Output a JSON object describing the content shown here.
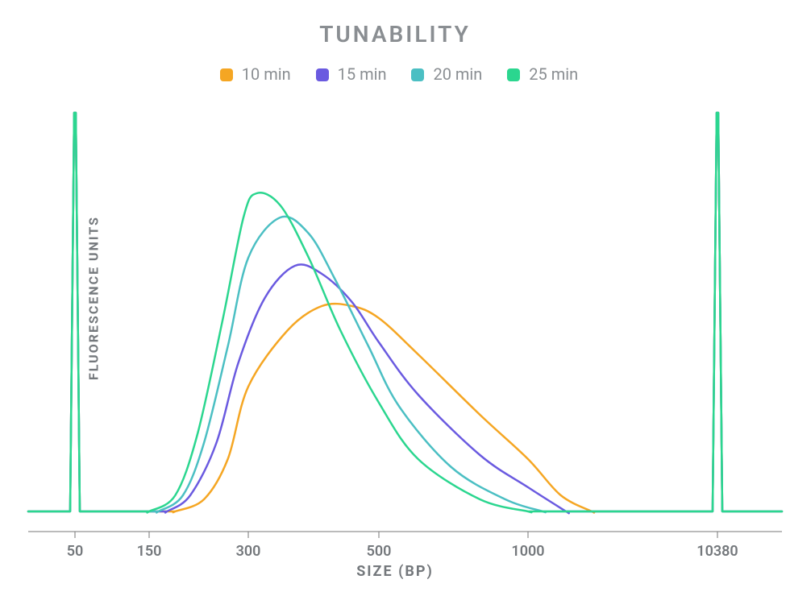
{
  "chart_data": {
    "type": "line",
    "title": "TUNABILITY",
    "xlabel": "SIZE (BP)",
    "ylabel": "FLUORESCENCE UNITS",
    "x_ticks": [
      50,
      150,
      300,
      500,
      1000,
      10380
    ],
    "x_axis_note": "logarithmic scale",
    "y_axis_note": "relative fluorescence, arbitrary units, baseline at 0",
    "legend": [
      {
        "name": "10 min",
        "color": "#f5a623"
      },
      {
        "name": "15 min",
        "color": "#6a5ae0"
      },
      {
        "name": "20 min",
        "color": "#4bbfc3"
      },
      {
        "name": "25 min",
        "color": "#2bd68f"
      }
    ],
    "marker_peaks": [
      {
        "x": 50,
        "height_rel": 1.0,
        "note": "lower marker spike, all series overlap"
      },
      {
        "x": 10380,
        "height_rel": 1.0,
        "note": "upper marker spike, all series overlap"
      }
    ],
    "series": [
      {
        "name": "10 min",
        "color": "#f5a623",
        "profile": {
          "rise_from_bp": 220,
          "peak_bp": 430,
          "peak_height_rel": 0.52,
          "fall_to_bp": 2200
        },
        "points": [
          {
            "x": 180,
            "y": 0.01
          },
          {
            "x": 220,
            "y": 0.04
          },
          {
            "x": 260,
            "y": 0.14
          },
          {
            "x": 300,
            "y": 0.32
          },
          {
            "x": 350,
            "y": 0.46
          },
          {
            "x": 400,
            "y": 0.52
          },
          {
            "x": 450,
            "y": 0.52
          },
          {
            "x": 500,
            "y": 0.49
          },
          {
            "x": 600,
            "y": 0.4
          },
          {
            "x": 800,
            "y": 0.25
          },
          {
            "x": 1000,
            "y": 0.14
          },
          {
            "x": 1500,
            "y": 0.05
          },
          {
            "x": 2200,
            "y": 0.01
          }
        ]
      },
      {
        "name": "15 min",
        "color": "#6a5ae0",
        "profile": {
          "rise_from_bp": 200,
          "peak_bp": 370,
          "peak_height_rel": 0.62,
          "fall_to_bp": 1600
        },
        "points": [
          {
            "x": 170,
            "y": 0.01
          },
          {
            "x": 200,
            "y": 0.05
          },
          {
            "x": 240,
            "y": 0.18
          },
          {
            "x": 280,
            "y": 0.38
          },
          {
            "x": 320,
            "y": 0.54
          },
          {
            "x": 360,
            "y": 0.62
          },
          {
            "x": 400,
            "y": 0.6
          },
          {
            "x": 450,
            "y": 0.53
          },
          {
            "x": 500,
            "y": 0.43
          },
          {
            "x": 600,
            "y": 0.3
          },
          {
            "x": 800,
            "y": 0.15
          },
          {
            "x": 1000,
            "y": 0.07
          },
          {
            "x": 1600,
            "y": 0.01
          }
        ]
      },
      {
        "name": "20 min",
        "color": "#4bbfc3",
        "profile": {
          "rise_from_bp": 190,
          "peak_bp": 340,
          "peak_height_rel": 0.74,
          "fall_to_bp": 1200
        },
        "points": [
          {
            "x": 160,
            "y": 0.01
          },
          {
            "x": 190,
            "y": 0.05
          },
          {
            "x": 220,
            "y": 0.18
          },
          {
            "x": 260,
            "y": 0.42
          },
          {
            "x": 300,
            "y": 0.64
          },
          {
            "x": 340,
            "y": 0.74
          },
          {
            "x": 380,
            "y": 0.7
          },
          {
            "x": 420,
            "y": 0.59
          },
          {
            "x": 480,
            "y": 0.42
          },
          {
            "x": 550,
            "y": 0.27
          },
          {
            "x": 700,
            "y": 0.12
          },
          {
            "x": 900,
            "y": 0.04
          },
          {
            "x": 1200,
            "y": 0.01
          }
        ]
      },
      {
        "name": "25 min",
        "color": "#2bd68f",
        "profile": {
          "rise_from_bp": 180,
          "peak_bp": 310,
          "peak_height_rel": 0.8,
          "fall_to_bp": 1000
        },
        "points": [
          {
            "x": 150,
            "y": 0.01
          },
          {
            "x": 180,
            "y": 0.05
          },
          {
            "x": 210,
            "y": 0.2
          },
          {
            "x": 250,
            "y": 0.48
          },
          {
            "x": 290,
            "y": 0.74
          },
          {
            "x": 310,
            "y": 0.8
          },
          {
            "x": 340,
            "y": 0.77
          },
          {
            "x": 380,
            "y": 0.64
          },
          {
            "x": 430,
            "y": 0.46
          },
          {
            "x": 500,
            "y": 0.28
          },
          {
            "x": 600,
            "y": 0.14
          },
          {
            "x": 800,
            "y": 0.04
          },
          {
            "x": 1000,
            "y": 0.01
          }
        ]
      }
    ]
  }
}
